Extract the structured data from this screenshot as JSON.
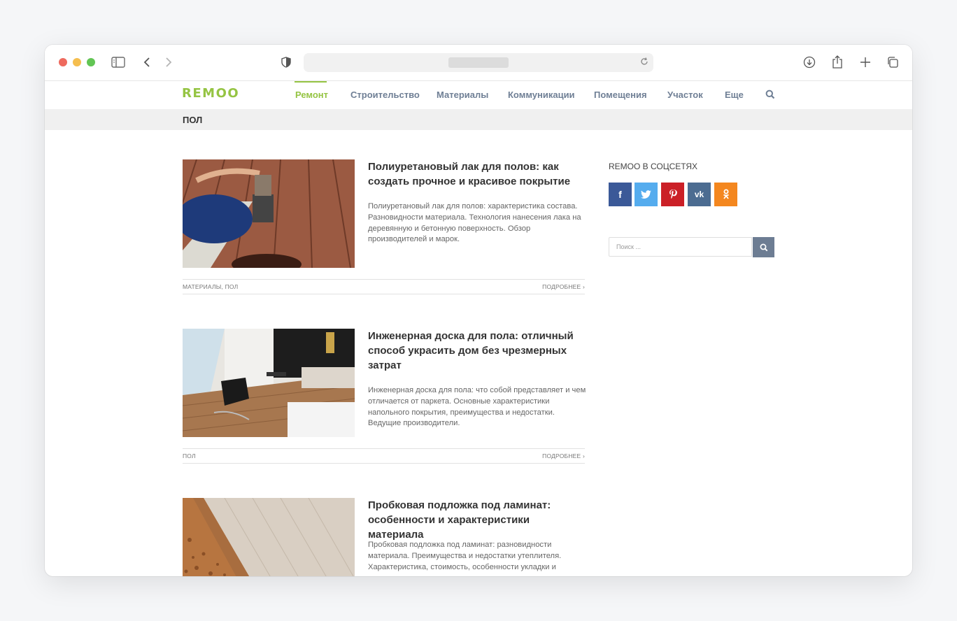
{
  "browser": {
    "icons": [
      "sidebar-icon",
      "back-icon",
      "forward-icon",
      "shield-icon",
      "reload-icon",
      "download-icon",
      "share-icon",
      "new-tab-icon",
      "tabs-icon"
    ]
  },
  "site": {
    "logo_text": "REMOO",
    "nav": [
      {
        "label": "Ремонт",
        "active": true
      },
      {
        "label": "Строительство"
      },
      {
        "label": "Материалы"
      },
      {
        "label": "Коммуникации"
      },
      {
        "label": "Помещения"
      },
      {
        "label": "Участок"
      },
      {
        "label": "Еще"
      }
    ],
    "colors": {
      "accent": "#95c443",
      "nav": "#6f7f95"
    }
  },
  "page_title": "ПОЛ",
  "articles": [
    {
      "title": "Полиуретановый лак для полов: как создать прочное и красивое покрытие",
      "excerpt": "Полиуретановый лак для полов: характеристика состава. Разновидности материала. Технология нанесения лака на деревянную и бетонную поверхность. Обзор производителей и марок.",
      "categories": "МАТЕРИАЛЫ, ПОЛ",
      "more": "ПОДРОБНЕЕ ›"
    },
    {
      "title": "Инженерная доска для пола: отличный способ украсить дом без чрезмерных затрат",
      "excerpt": "Инженерная доска для пола: что собой представляет и чем отличается от паркета. Основные характеристики напольного покрытия, преимущества и недостатки. Ведущие производители.",
      "categories": "ПОЛ",
      "more": "ПОДРОБНЕЕ ›"
    },
    {
      "title": "Пробковая подложка под ламинат: особенности и характеристики материала",
      "excerpt": "Пробковая подложка под ламинат: разновидности материала. Преимущества и недостатки утеплителя. Характеристика, стоимость, особенности укладки и",
      "categories": "",
      "more": ""
    }
  ],
  "sidebar": {
    "social_title": "REMOO В СОЦСЕТЯХ",
    "social": [
      {
        "name": "facebook",
        "glyph": "f",
        "color": "#3b5998"
      },
      {
        "name": "twitter",
        "glyph": "t",
        "color": "#55acee"
      },
      {
        "name": "pinterest",
        "glyph": "P",
        "color": "#cb2027"
      },
      {
        "name": "vk",
        "glyph": "vk",
        "color": "#4c6c91"
      },
      {
        "name": "odnoklassniki",
        "glyph": "ok",
        "color": "#f4871f"
      }
    ],
    "search_placeholder": "Поиск ..."
  }
}
